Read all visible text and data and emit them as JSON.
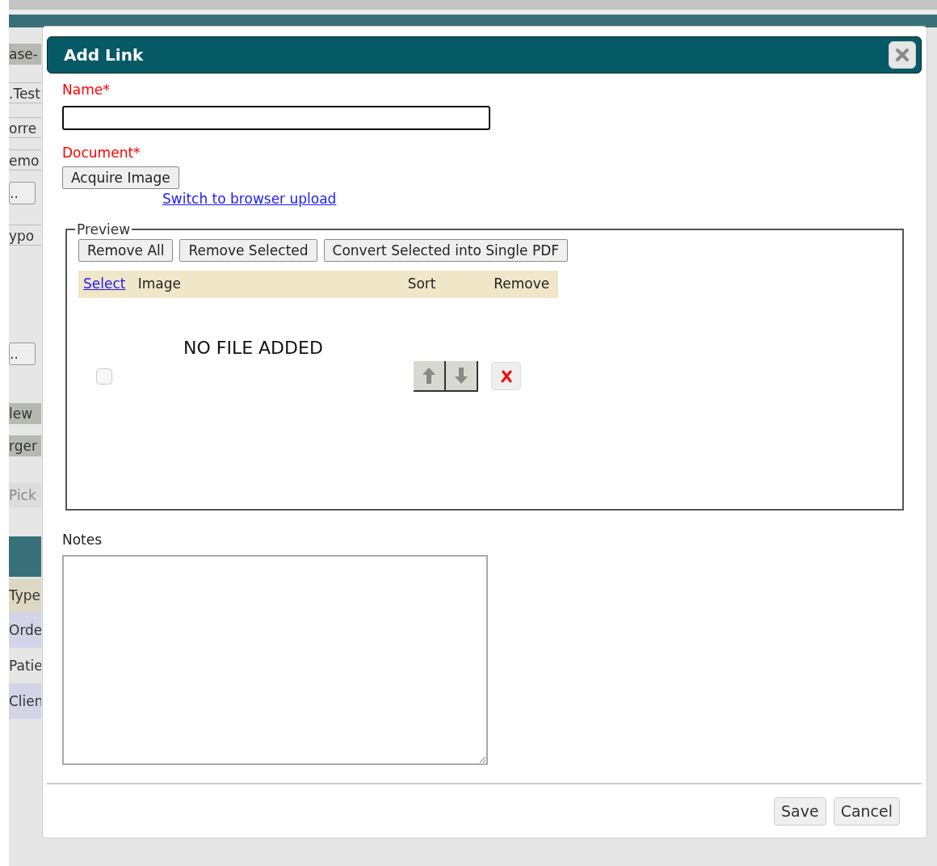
{
  "background_page": {
    "items": [
      {
        "kind": "button",
        "text": "ase-"
      },
      {
        "kind": "row",
        "text": ".Test"
      },
      {
        "kind": "row",
        "text": "orre"
      },
      {
        "kind": "row",
        "text": "emo"
      },
      {
        "kind": "small_button",
        "text": ".."
      },
      {
        "kind": "row",
        "text": "ypo"
      },
      {
        "kind": "small_button",
        "text": ".."
      },
      {
        "kind": "button",
        "text": "lew"
      },
      {
        "kind": "button",
        "text": "rger"
      },
      {
        "kind": "muted",
        "text": "Pick"
      },
      {
        "kind": "header"
      },
      {
        "kind": "column_heading",
        "text": "Type"
      },
      {
        "kind": "shaded",
        "text": "Orde"
      },
      {
        "kind": "plain",
        "text": "Patie"
      },
      {
        "kind": "shaded",
        "text": "Clien"
      }
    ]
  },
  "dialog": {
    "title": "Add Link",
    "fields": [
      {
        "label": "Name*",
        "required": true
      }
    ],
    "document": {
      "label": "Document*",
      "required": true,
      "button": "Acquire Image",
      "link": "Switch to browser upload"
    },
    "preview": {
      "legend": "Preview",
      "buttons": [
        "Remove All",
        "Remove Selected",
        "Convert Selected into Single PDF"
      ],
      "columns": [
        {
          "label": "Select",
          "kind": "link"
        },
        {
          "label": "Image",
          "kind": "text"
        },
        {
          "label": "Sort",
          "kind": "text"
        },
        {
          "label": "Remove",
          "kind": "text"
        }
      ],
      "rows": [
        {
          "checked": false,
          "image": "NO FILE ADDED"
        }
      ]
    },
    "notes": {
      "label": "Notes"
    },
    "buttons": [
      "Save",
      "Cancel"
    ]
  }
}
